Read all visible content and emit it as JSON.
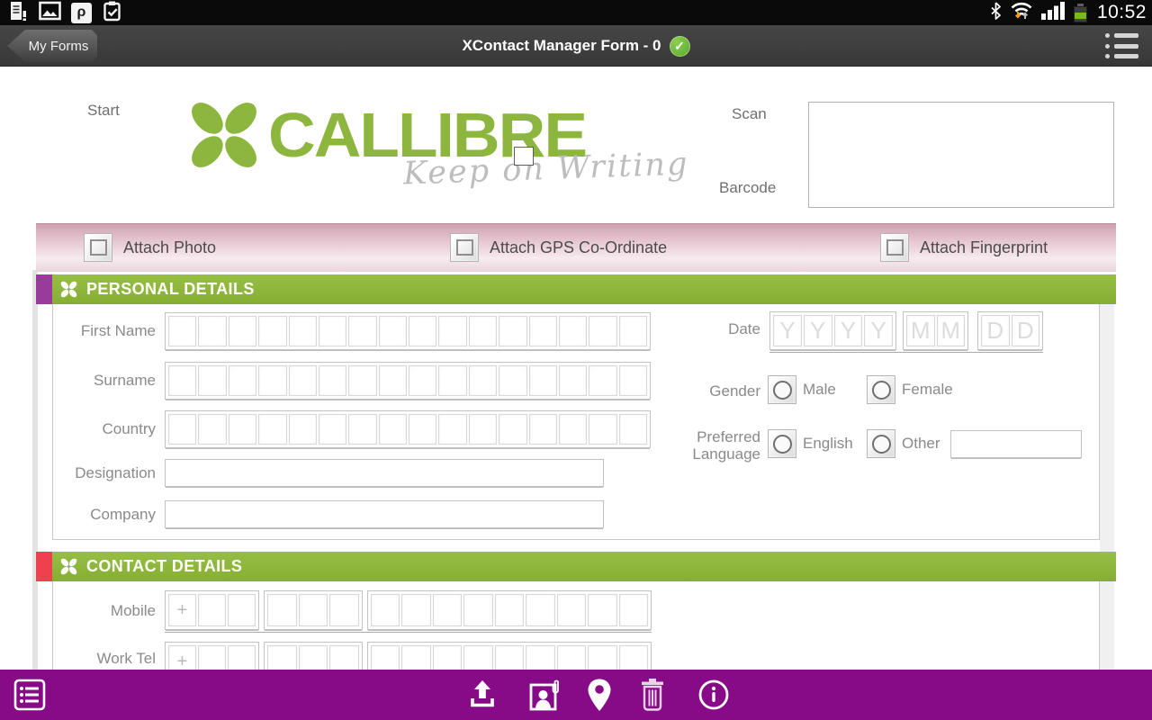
{
  "status_bar": {
    "time": "10:52",
    "notification_icons": [
      "document-alert-icon",
      "gallery-icon",
      "p-app-icon",
      "clipboard-check-icon"
    ],
    "system_icons": [
      "bluetooth-icon",
      "wifi-icon",
      "signal-icon",
      "battery-icon"
    ],
    "p_app_glyph": "ρ"
  },
  "app_bar": {
    "back_button_label": "My Forms",
    "title": "XContact Manager Form - 0",
    "status_icon": "green-check-icon",
    "check_glyph": "✓",
    "menu_icon": "list-menu-icon"
  },
  "form": {
    "start_label": "Start",
    "logo": {
      "text": "CALLIBRE",
      "tagline": "Keep on Writing"
    },
    "scan_label": "Scan",
    "barcode_label": "Barcode",
    "attach_options": [
      {
        "label": "Attach Photo"
      },
      {
        "label": "Attach GPS Co-Ordinate"
      },
      {
        "label": "Attach Fingerprint"
      }
    ],
    "personal_details": {
      "title": "PERSONAL DETAILS",
      "rows": [
        {
          "label": "First Name",
          "cells": 16
        },
        {
          "label": "Surname",
          "cells": 16
        },
        {
          "label": "Country",
          "cells": 16
        },
        {
          "label": "Designation",
          "type": "box"
        },
        {
          "label": "Company",
          "type": "box"
        }
      ],
      "date": {
        "label": "Date",
        "yyyy": [
          "Y",
          "Y",
          "Y",
          "Y"
        ],
        "mm": [
          "M",
          "M"
        ],
        "dd": [
          "D",
          "D"
        ]
      },
      "gender": {
        "label": "Gender",
        "male": "Male",
        "female": "Female"
      },
      "preferred_language": {
        "label_line1": "Preferred",
        "label_line2": "Language",
        "english": "English",
        "other": "Other"
      }
    },
    "contact_details": {
      "title": "CONTACT DETAILS",
      "rows": [
        {
          "label": "Mobile",
          "prefix": "+",
          "groups": [
            3,
            3,
            9
          ]
        },
        {
          "label": "Work Tel",
          "prefix": "+",
          "groups": [
            3,
            3,
            9
          ]
        }
      ]
    }
  },
  "toolbar": {
    "icons": [
      "forms-list-icon",
      "upload-icon",
      "attach-contact-icon",
      "location-icon",
      "delete-icon",
      "info-icon"
    ]
  },
  "colors": {
    "brand_green": "#8CB63E",
    "personal_tab_purple": "#993B9A",
    "contact_tab_red": "#EE4150",
    "toolbar_purple": "#870B87",
    "attach_bar_pink": "#D9A9B9",
    "check_green": "#5AA52E",
    "battery_green": "#76B82A",
    "wifi_arrow_orange": "#F19A1A"
  }
}
